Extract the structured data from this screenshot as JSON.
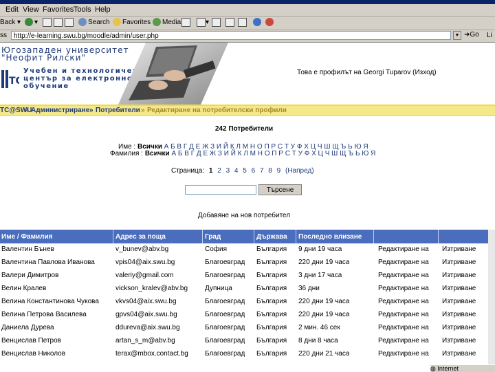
{
  "browser": {
    "menu": [
      "Edit",
      "View",
      "Favorites",
      "Tools",
      "Help"
    ],
    "toolbar": {
      "back": "Back",
      "search": "Search",
      "favorites": "Favorites",
      "media": "Media"
    },
    "address_label": "ss",
    "address_value": "http://e-learning.swu.bg/moodle/admin/user.php",
    "go_label": "Go",
    "links_label": "Li",
    "taskbar_item": "Internet"
  },
  "header": {
    "university_line1": "Югозападен университет",
    "university_line2": "\"Неофит Рилски\"",
    "center_line1": "Учебен и технологичен",
    "center_line2": "център за електронно",
    "center_line3": "обучение",
    "logo_text": "TC",
    "logged_in": "Това е профилът на Georgi Tuparov (Изход)"
  },
  "breadcrumb": {
    "home": "TC@SWU",
    "sep1": "»",
    "admin": "Администриране",
    "sep2": "»",
    "users": "Потребители",
    "sep3": "»",
    "current": "Редактиране на потребителски профили"
  },
  "summary": {
    "users_count": "242 Потребители"
  },
  "filter": {
    "name_label": "Име :",
    "surname_label": "Фамилия :",
    "all_label": "Всички",
    "letters": "А Б В Г Д Е Ж З И Й К Л М Н О П Р С Т У Ф Х Ц Ч Ш Щ Ъ Ь Ю Я"
  },
  "pagination": {
    "label": "Страница:",
    "pages": [
      "1",
      "2",
      "3",
      "4",
      "5",
      "6",
      "7",
      "8",
      "9"
    ],
    "next": "(Напред)"
  },
  "search": {
    "value": "",
    "button": "Търсене"
  },
  "add_user_link": "Добавяне на нов потребител",
  "table": {
    "headers": [
      "Име / Фамилия",
      "Адрес за поща",
      "Град",
      "Държава",
      "Последно влизане",
      "",
      ""
    ],
    "rows": [
      [
        "Валентин Бънев",
        "v_bunev@abv.bg",
        "София",
        "България",
        "9 дни 19 часа",
        "Редактиране на",
        "Изтриване"
      ],
      [
        "Валентина Павлова Иванова",
        "vpis04@aix.swu.bg",
        "Благоевград",
        "България",
        "220 дни 19 часа",
        "Редактиране на",
        "Изтриване"
      ],
      [
        "Валери Димитров",
        "valeriy@gmail.com",
        "Благоевград",
        "България",
        "3 дни 17 часа",
        "Редактиране на",
        "Изтриване"
      ],
      [
        "Велин Кралев",
        "vickson_kralev@abv.bg",
        "Дупница",
        "България",
        "36 дни",
        "Редактиране на",
        "Изтриване"
      ],
      [
        "Велина Константинова Чукова",
        "vkvs04@aix.swu.bg",
        "Благоевград",
        "България",
        "220 дни 19 часа",
        "Редактиране на",
        "Изтриване"
      ],
      [
        "Велина Петрова Василева",
        "gpvs04@aix.swu.bg",
        "Благоевград",
        "България",
        "220 дни 19 часа",
        "Редактиране на",
        "Изтриване"
      ],
      [
        "Даниела Дурева",
        "ddureva@aix.swu.bg",
        "Благоевград",
        "България",
        "2 мин. 46 сек",
        "Редактиране на",
        "Изтриване"
      ],
      [
        "Венцислав Петров",
        "artan_s_m@abv.bg",
        "Благоевград",
        "България",
        "8 дни 8 часа",
        "Редактиране на",
        "Изтриване"
      ],
      [
        "Венцислав Николов",
        "terax@mbox.contact.bg",
        "Благоевград",
        "България",
        "220 дни 21 часа",
        "Редактиране на",
        "Изтриване"
      ]
    ]
  }
}
